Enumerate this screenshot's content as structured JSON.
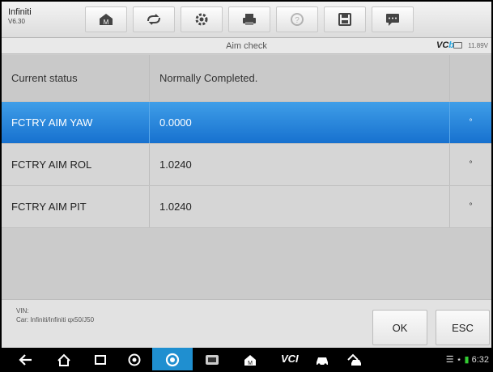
{
  "app": {
    "name": "Infiniti",
    "version": "V6.30"
  },
  "toolbar": {
    "buttons": [
      {
        "icon": "home-icon"
      },
      {
        "icon": "vehicle-swap-icon"
      },
      {
        "icon": "settings-gear-icon"
      },
      {
        "icon": "printer-icon"
      },
      {
        "icon": "help-icon"
      },
      {
        "icon": "save-icon"
      },
      {
        "icon": "message-icon"
      }
    ]
  },
  "subheader": {
    "title": "Aim check",
    "vci_logo": "VC",
    "vci_logo_b": "b",
    "voltage": "11.89V"
  },
  "table": {
    "header": {
      "label": "Current status",
      "value": "Normally Completed.",
      "unit": ""
    },
    "rows": [
      {
        "label": "FCTRY AIM YAW",
        "value": "0.0000",
        "unit": "°",
        "selected": true
      },
      {
        "label": "FCTRY AIM ROL",
        "value": "1.0240",
        "unit": "°",
        "selected": false
      },
      {
        "label": "FCTRY AIM PIT",
        "value": "1.0240",
        "unit": "°",
        "selected": false
      }
    ]
  },
  "footer": {
    "vin_label": "VIN:",
    "car_label": "Car: Infiniti/Infiniti qx50/J50",
    "ok_label": "OK",
    "esc_label": "ESC"
  },
  "navbar": {
    "vci_label": "VCI",
    "clock": "6:32"
  },
  "colors": {
    "selected_row": "#1f7fd8",
    "camera_tab": "#1f8fd0",
    "vci_accent": "#2aa7e0"
  }
}
